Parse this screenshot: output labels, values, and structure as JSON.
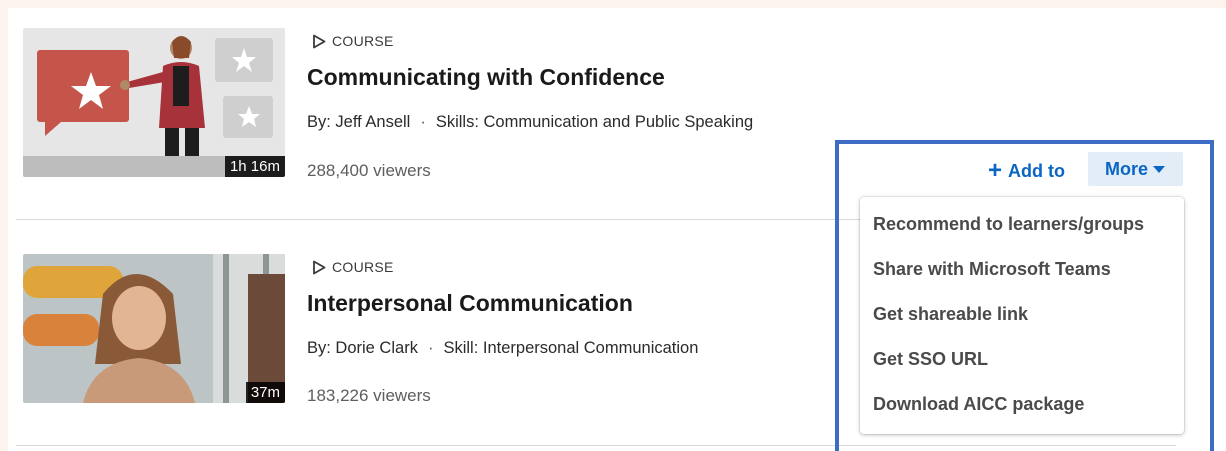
{
  "courses": [
    {
      "tag": "COURSE",
      "title": "Communicating with Confidence",
      "byline": "By: Jeff Ansell",
      "skills": "Skills: Communication and Public Speaking",
      "viewers": "288,400 viewers",
      "duration": "1h 16m"
    },
    {
      "tag": "COURSE",
      "title": "Interpersonal Communication",
      "byline": "By: Dorie Clark",
      "skills": "Skill: Interpersonal Communication",
      "viewers": "183,226 viewers",
      "duration": "37m"
    }
  ],
  "actions": {
    "add_to_label": "Add to",
    "more_label": "More"
  },
  "dropdown": {
    "items": [
      "Recommend to learners/groups",
      "Share with Microsoft Teams",
      "Get shareable link",
      "Get SSO URL",
      "Download AICC package"
    ]
  },
  "colors": {
    "accent": "#0a66c2",
    "highlight_border": "#3d6cc4",
    "page_background": "#fdf3ef"
  },
  "icons": {
    "course_tag": "play-outline-icon",
    "add": "plus-icon",
    "more": "caret-down-icon"
  }
}
